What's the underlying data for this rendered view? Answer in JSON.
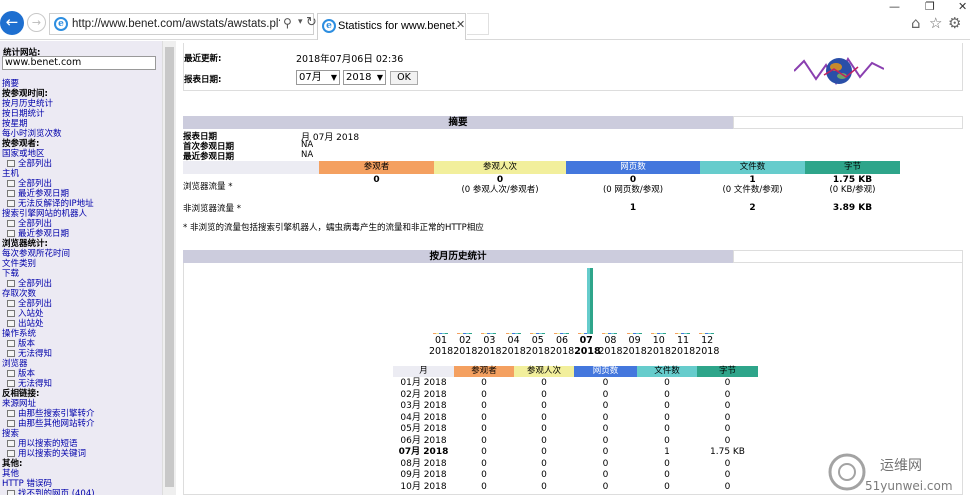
{
  "browser": {
    "url": "http://www.benet.com/awstats/awstats.pl?co",
    "tab_title": "Statistics for www.benet.",
    "tab_close": "✕"
  },
  "menu": {
    "site_label": "统计网站:",
    "site_value": "www.benet.com",
    "items": [
      {
        "text": "摘要",
        "kind": "link"
      },
      {
        "text": "按参观时间:",
        "kind": "hdr"
      },
      {
        "text": "按月历史统计",
        "kind": "link"
      },
      {
        "text": "按日期统计",
        "kind": "link"
      },
      {
        "text": "按星期",
        "kind": "link"
      },
      {
        "text": "每小时浏览次数",
        "kind": "link"
      },
      {
        "text": "按参观者:",
        "kind": "hdr"
      },
      {
        "text": "国家或地区",
        "kind": "link"
      },
      {
        "text": "全部列出",
        "kind": "sub"
      },
      {
        "text": "主机",
        "kind": "link"
      },
      {
        "text": "全部列出",
        "kind": "sub"
      },
      {
        "text": "最近参观日期",
        "kind": "sub"
      },
      {
        "text": "无法反解译的IP地址",
        "kind": "sub"
      },
      {
        "text": "搜索引擎网站的机器人",
        "kind": "link"
      },
      {
        "text": "全部列出",
        "kind": "sub"
      },
      {
        "text": "最近参观日期",
        "kind": "sub"
      },
      {
        "text": "浏览器统计:",
        "kind": "hdr"
      },
      {
        "text": "每次参观所花时间",
        "kind": "link"
      },
      {
        "text": "文件类别",
        "kind": "link"
      },
      {
        "text": "下载",
        "kind": "link"
      },
      {
        "text": "全部列出",
        "kind": "sub"
      },
      {
        "text": "存取次数",
        "kind": "link"
      },
      {
        "text": "全部列出",
        "kind": "sub"
      },
      {
        "text": "入站处",
        "kind": "sub"
      },
      {
        "text": "出站处",
        "kind": "sub"
      },
      {
        "text": "操作系统",
        "kind": "link"
      },
      {
        "text": "版本",
        "kind": "sub"
      },
      {
        "text": "无法得知",
        "kind": "sub"
      },
      {
        "text": "浏览器",
        "kind": "link"
      },
      {
        "text": "版本",
        "kind": "sub"
      },
      {
        "text": "无法得知",
        "kind": "sub"
      },
      {
        "text": "反相链接:",
        "kind": "hdr"
      },
      {
        "text": "来源网址",
        "kind": "link"
      },
      {
        "text": "由那些搜索引擎转介",
        "kind": "sub"
      },
      {
        "text": "由那些其他网站转介",
        "kind": "sub"
      },
      {
        "text": "搜索",
        "kind": "link"
      },
      {
        "text": "用以搜索的短语",
        "kind": "sub"
      },
      {
        "text": "用以搜索的关键词",
        "kind": "sub"
      },
      {
        "text": "其他:",
        "kind": "hdr"
      },
      {
        "text": "其他",
        "kind": "link"
      },
      {
        "text": "HTTP 错误码",
        "kind": "link"
      },
      {
        "text": "找不到的网页 (404)",
        "kind": "sub"
      }
    ]
  },
  "header": {
    "last_update_label": "最近更新:",
    "last_update_value": "2018年07月06日 02:36",
    "report_date_label": "报表日期:",
    "month_select": "07月",
    "year_select": "2018",
    "ok_label": "OK"
  },
  "summary": {
    "title": "摘要",
    "report_date_label": "报表日期",
    "report_date_value": "月 07月 2018",
    "first_visit_label": "首次参观日期",
    "first_visit_value": "NA",
    "last_visit_label": "最近参观日期",
    "last_visit_value": "NA",
    "columns": [
      "参观者",
      "参观人次",
      "网页数",
      "文件数",
      "字节"
    ],
    "column_colors": [
      "#f4a060",
      "#f2ef9c",
      "#4477dd",
      "#66cccc",
      "#2ea58a"
    ],
    "browser_traffic_label": "浏览器流量 *",
    "browser_traffic": [
      "0",
      "0",
      "0",
      "1",
      "1.75 KB"
    ],
    "browser_traffic_sub": [
      "",
      "(0 参观人次/参观者)",
      "(0 网页数/参观)",
      "(0 文件数/参观)",
      "(0 KB/参观)"
    ],
    "nonbrowser_traffic_label": "非浏览器流量 *",
    "nonbrowser_traffic": [
      "",
      "",
      "1",
      "2",
      "3.89 KB"
    ],
    "footnote": "* 非浏览的流量包括搜索引擎机器人，蠕虫病毒产生的流量和非正常的HTTP相应"
  },
  "monthly": {
    "title": "按月历史统计",
    "months": [
      "01",
      "02",
      "03",
      "04",
      "05",
      "06",
      "07",
      "08",
      "09",
      "10",
      "11",
      "12"
    ],
    "year": "2018",
    "current_month_index": 6,
    "table_headers": [
      "月",
      "参观者",
      "参观人次",
      "网页数",
      "文件数",
      "字节"
    ],
    "rows": [
      {
        "month": "01月 2018",
        "visitors": "0",
        "visits": "0",
        "pages": "0",
        "hits": "0",
        "bytes": "0"
      },
      {
        "month": "02月 2018",
        "visitors": "0",
        "visits": "0",
        "pages": "0",
        "hits": "0",
        "bytes": "0"
      },
      {
        "month": "03月 2018",
        "visitors": "0",
        "visits": "0",
        "pages": "0",
        "hits": "0",
        "bytes": "0"
      },
      {
        "month": "04月 2018",
        "visitors": "0",
        "visits": "0",
        "pages": "0",
        "hits": "0",
        "bytes": "0"
      },
      {
        "month": "05月 2018",
        "visitors": "0",
        "visits": "0",
        "pages": "0",
        "hits": "0",
        "bytes": "0"
      },
      {
        "month": "06月 2018",
        "visitors": "0",
        "visits": "0",
        "pages": "0",
        "hits": "0",
        "bytes": "0"
      },
      {
        "month": "07月 2018",
        "visitors": "0",
        "visits": "0",
        "pages": "0",
        "hits": "1",
        "bytes": "1.75 KB",
        "current": true
      },
      {
        "month": "08月 2018",
        "visitors": "0",
        "visits": "0",
        "pages": "0",
        "hits": "0",
        "bytes": "0"
      },
      {
        "month": "09月 2018",
        "visitors": "0",
        "visits": "0",
        "pages": "0",
        "hits": "0",
        "bytes": "0"
      },
      {
        "month": "10月 2018",
        "visitors": "0",
        "visits": "0",
        "pages": "0",
        "hits": "0",
        "bytes": "0"
      }
    ],
    "bar_values": {
      "visitors": 0,
      "visits": 0,
      "pages": 0,
      "hits": 1,
      "bytes": 1.75
    }
  },
  "watermark": {
    "cn": "运维网",
    "en": "51yunwei.com"
  }
}
